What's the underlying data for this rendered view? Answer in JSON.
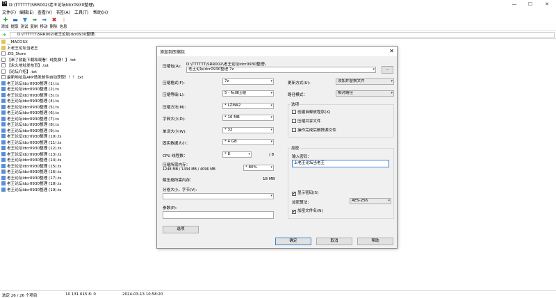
{
  "window": {
    "app_icon": "7z",
    "title": "D:\\TTTTTT\\SRR002\\老王论坛ldcr0930整理\\",
    "controls": [
      "—",
      "☐",
      "✕"
    ]
  },
  "menu": [
    "文件(F)",
    "编辑(E)",
    "查看(V)",
    "书签(A)",
    "工具(T)",
    "帮助(H)"
  ],
  "toolbar": [
    {
      "label": "添加",
      "icon": "plus-icon",
      "glyph": "✚",
      "color": "#2a9a3a"
    },
    {
      "label": "提取",
      "icon": "minus-icon",
      "glyph": "▬",
      "color": "#2563c9"
    },
    {
      "label": "测试",
      "icon": "check-icon",
      "glyph": "▼",
      "color": "#2a8fc9"
    },
    {
      "label": "复制",
      "icon": "copy-icon",
      "glyph": "➡",
      "color": "#2a9a6a"
    },
    {
      "label": "移动",
      "icon": "move-icon",
      "glyph": "➡",
      "color": "#3a7ad8"
    },
    {
      "label": "删除",
      "icon": "delete-icon",
      "glyph": "✖",
      "color": "#d32020"
    },
    {
      "label": "信息",
      "icon": "info-icon",
      "glyph": "i",
      "color": "#c8a020"
    }
  ],
  "address": {
    "path": "D:\\TTTTTT\\SRR002\\老王论坛ldcr0930整理\\"
  },
  "files": [
    {
      "name": "__MACOSX",
      "type": "folder"
    },
    {
      "name": "上老王论坛当老王",
      "type": "folder"
    },
    {
      "name": ".DS_Store",
      "type": "file"
    },
    {
      "name": "【来了就能下载和观看！纯免费！】.txt",
      "type": "file"
    },
    {
      "name": "【永久地址发布页】.txt",
      "type": "file"
    },
    {
      "name": "【论坛介绍】.txt",
      "type": "file"
    },
    {
      "name": "最新地址及APP请发邮件自动获取！！！.txt",
      "type": "file"
    },
    {
      "name": "老王论坛ldcr0930整理 (1).ts",
      "type": "ts"
    },
    {
      "name": "老王论坛ldcr0930整理 (2).ts",
      "type": "ts"
    },
    {
      "name": "老王论坛ldcr0930整理 (3).ts",
      "type": "ts"
    },
    {
      "name": "老王论坛ldcr0930整理 (4).ts",
      "type": "ts"
    },
    {
      "name": "老王论坛ldcr0930整理 (5).ts",
      "type": "ts"
    },
    {
      "name": "老王论坛ldcr0930整理 (6).ts",
      "type": "ts"
    },
    {
      "name": "老王论坛ldcr0930整理 (7).ts",
      "type": "ts"
    },
    {
      "name": "老王论坛ldcr0930整理 (8).ts",
      "type": "ts"
    },
    {
      "name": "老王论坛ldcr0930整理 (9).ts",
      "type": "ts"
    },
    {
      "name": "老王论坛ldcr0930整理 (10).ts",
      "type": "ts"
    },
    {
      "name": "老王论坛ldcr0930整理 (11).ts",
      "type": "ts"
    },
    {
      "name": "老王论坛ldcr0930整理 (12).ts",
      "type": "ts"
    },
    {
      "name": "老王论坛ldcr0930整理 (13).ts",
      "type": "ts"
    },
    {
      "name": "老王论坛ldcr0930整理 (14).ts",
      "type": "ts"
    },
    {
      "name": "老王论坛ldcr0930整理 (15).ts",
      "type": "ts"
    },
    {
      "name": "老王论坛ldcr0930整理 (16).ts",
      "type": "ts"
    },
    {
      "name": "老王论坛ldcr0930整理 (17).ts",
      "type": "ts"
    },
    {
      "name": "老王论坛ldcr0930整理 (18).ts",
      "type": "ts"
    },
    {
      "name": "老王论坛ldcr0930整理 (19).ts",
      "type": "ts"
    }
  ],
  "status": {
    "selection": "选定 26 / 26 个项目",
    "size": "10 131 615 8: 0",
    "modified": "2024-03-13 10:58:20"
  },
  "dialog": {
    "title": "添加到压缩包",
    "close": "✕",
    "archive_label": "压缩包(A):",
    "archive_path": "D:\\TTTTTT\\SRR002\\老王论坛ldcr0930整理\\",
    "archive_name": "老王论坛ldcr0930整理.7z",
    "browse_label": "...",
    "format_label": "压缩格式(F):",
    "format_value": "7z",
    "level_label": "压缩等级(L):",
    "level_value": "5 - 标准压缩",
    "method_label": "压缩方法(M):",
    "method_value": "* LZMA2",
    "dict_label": "字典大小(D):",
    "dict_value": "* 16 MB",
    "word_label": "单词大小(W):",
    "word_value": "* 32",
    "solid_label": "固实数据大小：",
    "solid_value": "* 4 GB",
    "cpu_label": "CPU 线程数：",
    "cpu_value": "* 8",
    "cpu_total": "/ 8",
    "mem_label": "压缩所需内存：",
    "mem_detail": "1248 MB / 1434 MB / 4096 MB",
    "mem_value": "* 80%",
    "decomp_label": "解压缩所需内存：",
    "decomp_value": "18 MB",
    "split_label": "分卷大小，字节(V):",
    "split_value": "",
    "params_label": "参数(P):",
    "params_value": "",
    "options_button": "选项",
    "update_label": "更新方式(U):",
    "update_value": "添加并替换文件",
    "pathmode_label": "路径模式：",
    "pathmode_value": "相对路径",
    "options_group": "选项",
    "opt_sfx": "创建自释放程序(X)",
    "opt_shared": "压缩共享文件",
    "opt_delete": "操作完成后删除源文件",
    "encrypt_group": "加密",
    "password_label": "输入密码：",
    "password_value": "上老王论坛当老王",
    "show_password": "显示密码(S)",
    "show_password_checked": "✔",
    "enc_method_label": "加密算法：",
    "enc_method_value": "AES-256",
    "encrypt_names": "加密文件名(N)",
    "encrypt_names_checked": "✔",
    "ok_button": "确定",
    "cancel_button": "取消",
    "help_button": "帮助"
  }
}
